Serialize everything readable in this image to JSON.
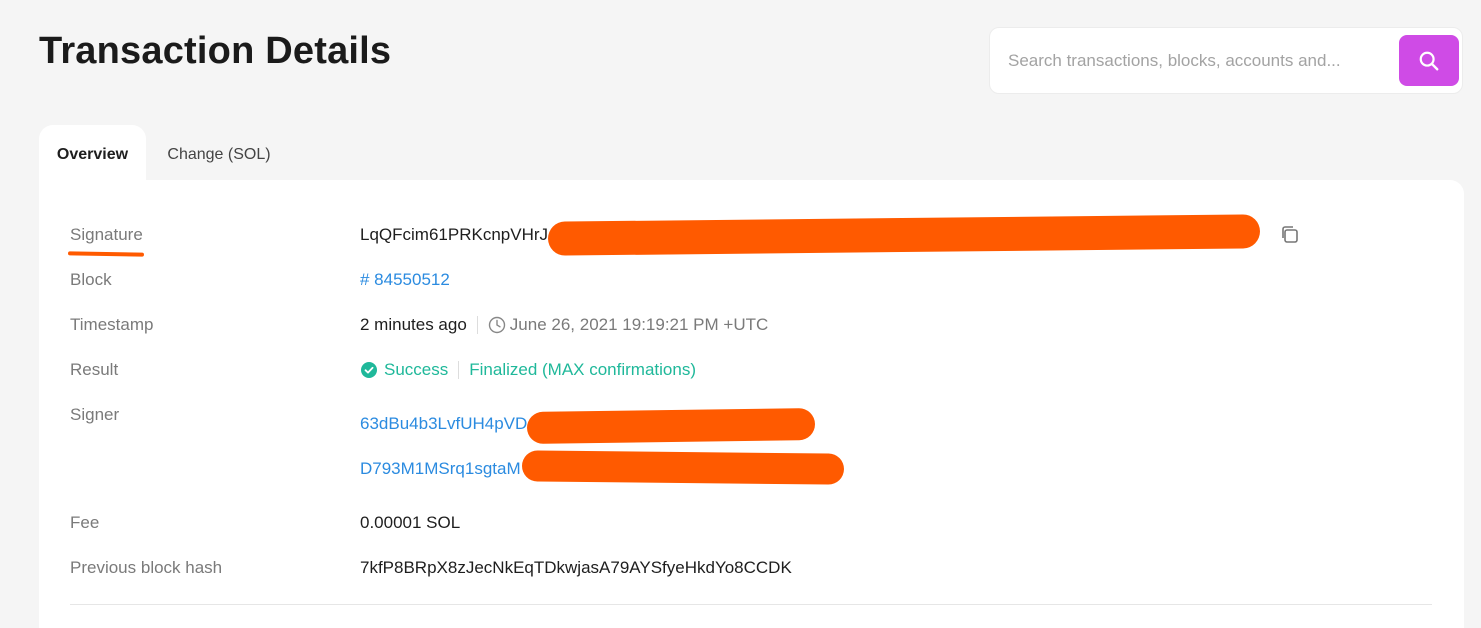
{
  "header": {
    "title": "Transaction Details"
  },
  "search": {
    "placeholder": "Search transactions, blocks, accounts and..."
  },
  "tabs": [
    {
      "label": "Overview",
      "active": true
    },
    {
      "label": "Change (SOL)",
      "active": false
    }
  ],
  "details": {
    "signature": {
      "label": "Signature",
      "value": "LqQFcim61PRKcnpVHrJ"
    },
    "block": {
      "label": "Block",
      "value": "# 84550512"
    },
    "timestamp": {
      "label": "Timestamp",
      "relative": "2 minutes ago",
      "absolute": "June 26, 2021 19:19:21 PM +UTC"
    },
    "result": {
      "label": "Result",
      "status": "Success",
      "confirmation": "Finalized (MAX confirmations)"
    },
    "signer": {
      "label": "Signer",
      "values": [
        "63dBu4b3LvfUH4pVD",
        "D793M1MSrq1sgtaM"
      ]
    },
    "fee": {
      "label": "Fee",
      "value": "0.00001 SOL"
    },
    "previous_block_hash": {
      "label": "Previous block hash",
      "value": "7kfP8BRpX8zJecNkEqTDkwjasA79AYSfyeHkdYo8CCDK"
    }
  },
  "icons": {
    "search": "search-icon",
    "copy": "copy-icon",
    "clock": "clock-icon",
    "success": "check-circle-icon"
  },
  "colors": {
    "accent": "#cf4be6",
    "link": "#2b8be0",
    "success": "#1fb89a",
    "redaction": "#ff5a00"
  }
}
